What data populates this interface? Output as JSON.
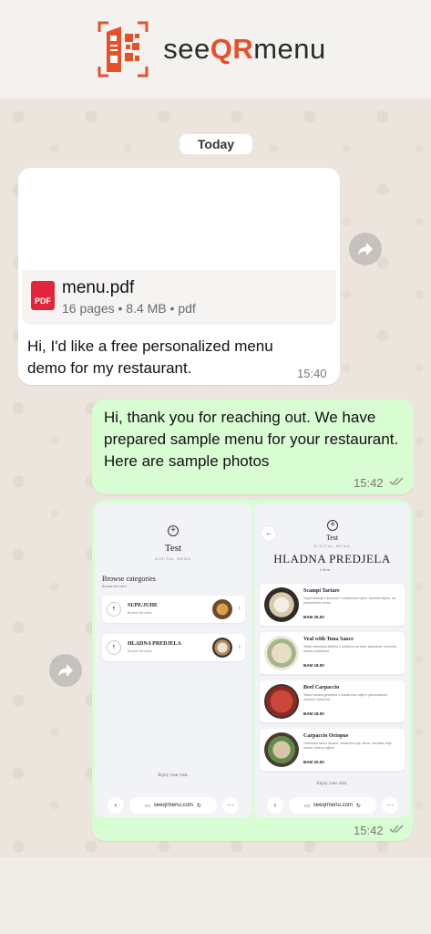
{
  "header": {
    "brand_prefix": "see",
    "brand_accent": "QR",
    "brand_suffix": "menu",
    "accent_color": "#e8502a"
  },
  "chat": {
    "date_label": "Today",
    "incoming": {
      "file_name": "menu.pdf",
      "file_meta": "16 pages • 8.4 MB • pdf",
      "file_type_badge": "PDF",
      "text": "Hi, I'd like a free personalized menu demo for my restaurant.",
      "time": "15:40"
    },
    "outgoing_text": {
      "text": "Hi, thank you for reaching out. We have prepared sample menu for your restaurant. Here are sample photos",
      "time": "15:42"
    },
    "outgoing_images": {
      "time": "15:42",
      "shot1": {
        "title": "Test",
        "subtitle": "DIGITAL MENU",
        "section_heading": "Browse categories",
        "section_hint": "Browse the menu",
        "categories": [
          {
            "name": "SUPE/JUHE",
            "desc": "Browse the menu"
          },
          {
            "name": "HLADNA PREDJELA",
            "desc": "Browse the menu"
          }
        ],
        "footer": "Enjoy your visit.",
        "url": "seeqrmenu.com"
      },
      "shot2": {
        "title": "Test",
        "subtitle": "DIGITAL MENU",
        "page_heading": "HLADNA PREDJELA",
        "hint": "4 items",
        "dishes": [
          {
            "name": "Scampi Tartare",
            "desc": "Svježi škampi s limunom i maslinovim uljem, začinski biljem, na prepečenom kruhu",
            "price": "BAM 25.00"
          },
          {
            "name": "Veal with Tuna Sauce",
            "desc": "Tanko narezana teletina s umakom od tune, kaparima i limunom, hladno posluženo",
            "price": "BAM 18.00"
          },
          {
            "name": "Beef Carpaccio",
            "desc": "Tanko rezana govedina s maslinovim uljem i parmezanom, rukolom i limunom",
            "price": "BAM 18.00"
          },
          {
            "name": "Carpaccio Octopus",
            "desc": "Hobotnica tanko rezana, maslinovo ulje, limun, začinsko bilje, rukola i cherry rajčice",
            "price": "BAM 20.00"
          }
        ],
        "footer": "Enjoy your visit.",
        "url": "seeqrmenu.com"
      }
    }
  },
  "icons": {
    "forward": "forward-arrow-icon",
    "read_receipt": "double-check-icon"
  }
}
